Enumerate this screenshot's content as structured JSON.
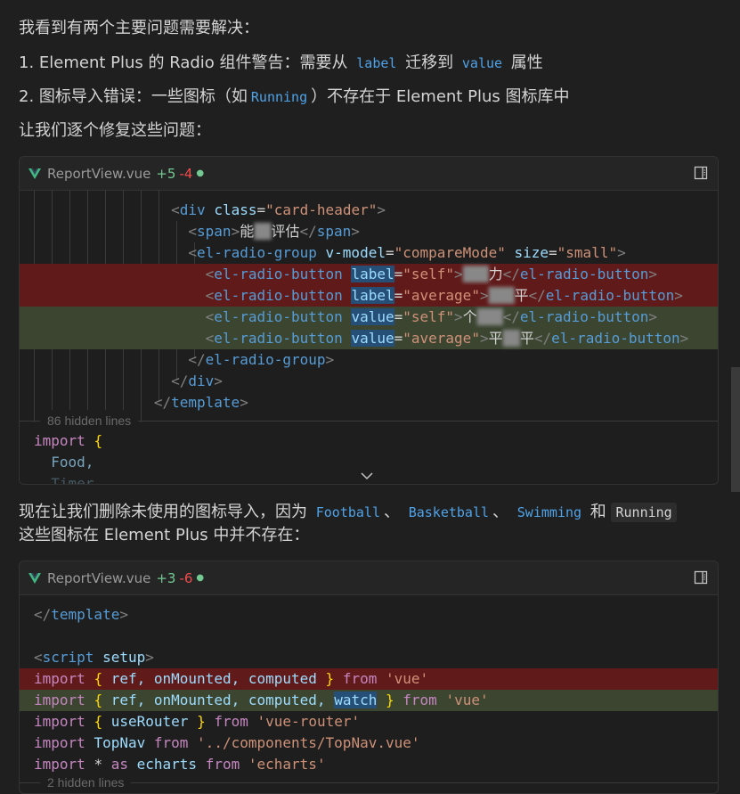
{
  "intro": {
    "line1": "我看到有两个主要问题需要解决：",
    "item1_pre": "1. Element Plus 的 Radio 组件警告：需要从",
    "item1_code1": "label",
    "item1_mid": "迁移到",
    "item1_code2": "value",
    "item1_post": "属性",
    "item2_pre": "2. 图标导入错误：一些图标（如",
    "item2_code": "Running",
    "item2_post": "）不存在于 Element Plus 图标库中",
    "line_fix": "让我们逐个修复这些问题："
  },
  "block1": {
    "filename": "ReportView.vue",
    "added": "+5",
    "removed": "-4",
    "dot": "●",
    "hidden": "86 hidden lines",
    "lines": {
      "l1_tag": "div",
      "l1_attr": "class",
      "l1_val": "\"card-header\"",
      "l2_tag": "span",
      "l2_text_a": "能",
      "l2_text_b": "评估",
      "l2_close": "span",
      "l3_tag": "el-radio-group",
      "l3_attr1": "v-model",
      "l3_val1": "\"compareMode\"",
      "l3_attr2": "size",
      "l3_val2": "\"small\"",
      "l4_tag": "el-radio-button",
      "l4_attr": "label",
      "l4_val": "\"self\"",
      "l4_text": "力",
      "l4_close": "el-radio-button",
      "l5_tag": "el-radio-button",
      "l5_attr": "label",
      "l5_val": "\"average\"",
      "l5_text": "平",
      "l5_close": "el-radio-button",
      "l6_tag": "el-radio-button",
      "l6_attr": "value",
      "l6_val": "\"self\"",
      "l6_text": "个",
      "l6_close": "el-radio-button",
      "l7_tag": "el-radio-button",
      "l7_attr": "value",
      "l7_val": "\"average\"",
      "l7_text_a": "平",
      "l7_text_b": "平",
      "l7_close": "el-radio-button",
      "l8_close": "el-radio-group",
      "l9_close": "div",
      "l10_close": "template",
      "l11_kw": "import",
      "l11_brace": "{",
      "l12_id": "Food,",
      "l13_id": "Timer"
    }
  },
  "middle": {
    "pre": "现在让我们删除未使用的图标导入，因为",
    "c1": "Football",
    "sep1": "、",
    "c2": "Basketball",
    "sep2": "、",
    "c3": "Swimming",
    "and": "和",
    "c4": "Running",
    "line2": "这些图标在 Element Plus 中并不存在："
  },
  "block2": {
    "filename": "ReportView.vue",
    "added": "+3",
    "removed": "-6",
    "dot": "●",
    "hidden": "2 hidden lines",
    "lines": {
      "a1": "template",
      "a3": "script",
      "a3_attr": "setup",
      "rm_import": "import",
      "rm_ids": "ref, onMounted, computed",
      "rm_from": "from",
      "rm_str": "'vue'",
      "ad_import": "import",
      "ad_ids": "ref, onMounted, computed,",
      "ad_watch": "watch",
      "ad_from": "from",
      "ad_str": "'vue'",
      "r_import": "import",
      "r_ids": "useRouter",
      "r_from": "from",
      "r_str": "'vue-router'",
      "t_import": "import",
      "t_id": "TopNav",
      "t_from": "from",
      "t_str": "'../components/TopNav.vue'",
      "e_import": "import",
      "e_star": "*",
      "e_as": "as",
      "e_id": "echarts",
      "e_from": "from",
      "e_str": "'echarts'"
    }
  },
  "icons": [
    "vue-icon",
    "open-in-editor-icon",
    "chevron-down-icon"
  ],
  "colors": {
    "removed_bg": "#611a1a",
    "added_bg": "#3b4530",
    "accent": "#4fa3e8"
  }
}
